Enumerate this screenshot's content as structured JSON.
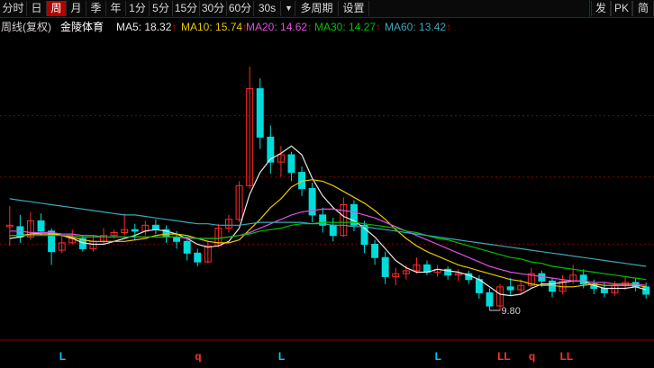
{
  "toolbar": {
    "periods": [
      "分时",
      "日",
      "周",
      "月",
      "季",
      "年",
      "1分",
      "5分",
      "15分",
      "30分",
      "60分",
      "30s"
    ],
    "active_period": "周",
    "dropdown_arrow": "▼",
    "multi_period": "多周期",
    "settings": "设置",
    "right_buttons": [
      "发",
      "PK",
      "简"
    ]
  },
  "infobar": {
    "chart_type": "周线(复权)",
    "stock_name": "金陵体育",
    "ma": [
      {
        "label": "MA5: 18.32",
        "color": "#e8e8e8"
      },
      {
        "label": "MA10: 15.74",
        "color": "#e8c800"
      },
      {
        "label": "MA20: 14.62",
        "color": "#e050e0"
      },
      {
        "label": "MA30: 14.27",
        "color": "#00c000"
      },
      {
        "label": "MA60: 13.42",
        "color": "#3aa8b8"
      }
    ],
    "up_arrow": "↑"
  },
  "colors": {
    "up": "#ff2a2a",
    "down": "#00dcdc",
    "grid": "#8b0000",
    "signal_L": "#00c8ff",
    "signal_q": "#ff3030"
  },
  "chart_data": {
    "type": "candlestick",
    "title": "金陵体育 周线(复权)",
    "ylim": [
      9.0,
      28.0
    ],
    "low_marker": "9.80",
    "candles": [
      [
        15.5,
        16.9,
        14.2,
        15.6
      ],
      [
        15.5,
        16.3,
        14.4,
        14.8
      ],
      [
        14.8,
        16.5,
        14.6,
        15.9
      ],
      [
        15.9,
        16.4,
        14.9,
        15.2
      ],
      [
        15.2,
        15.4,
        12.9,
        13.8
      ],
      [
        13.9,
        14.9,
        13.7,
        14.4
      ],
      [
        14.4,
        15.3,
        14.3,
        14.7
      ],
      [
        14.7,
        14.9,
        13.8,
        14.0
      ],
      [
        14.0,
        14.9,
        13.8,
        14.5
      ],
      [
        14.5,
        15.4,
        14.3,
        14.9
      ],
      [
        14.9,
        15.3,
        14.7,
        15.1
      ],
      [
        15.1,
        16.4,
        14.9,
        15.3
      ],
      [
        15.3,
        15.7,
        14.6,
        15.2
      ],
      [
        15.2,
        15.9,
        14.9,
        15.6
      ],
      [
        15.6,
        16.0,
        15.0,
        15.3
      ],
      [
        15.3,
        15.6,
        14.4,
        14.8
      ],
      [
        14.8,
        15.2,
        14.0,
        14.5
      ],
      [
        14.5,
        14.8,
        13.2,
        13.7
      ],
      [
        13.7,
        14.0,
        12.8,
        13.1
      ],
      [
        13.1,
        14.6,
        13.0,
        14.2
      ],
      [
        14.2,
        15.7,
        14.1,
        15.4
      ],
      [
        15.4,
        16.3,
        15.1,
        16.0
      ],
      [
        16.0,
        18.6,
        15.8,
        18.3
      ],
      [
        18.3,
        26.4,
        18.1,
        24.9
      ],
      [
        24.9,
        25.6,
        20.8,
        21.6
      ],
      [
        21.6,
        22.4,
        19.1,
        19.9
      ],
      [
        19.9,
        21.0,
        18.9,
        20.4
      ],
      [
        20.4,
        20.6,
        18.6,
        19.2
      ],
      [
        19.2,
        19.6,
        17.6,
        18.1
      ],
      [
        18.1,
        18.5,
        15.8,
        16.3
      ],
      [
        16.3,
        16.8,
        15.1,
        15.6
      ],
      [
        15.6,
        16.1,
        14.5,
        14.9
      ],
      [
        14.9,
        17.5,
        14.8,
        17.0
      ],
      [
        17.0,
        17.3,
        15.2,
        15.6
      ],
      [
        15.6,
        15.9,
        13.7,
        14.3
      ],
      [
        14.3,
        14.6,
        12.9,
        13.4
      ],
      [
        13.4,
        13.8,
        11.6,
        12.1
      ],
      [
        12.1,
        12.7,
        11.5,
        12.3
      ],
      [
        12.3,
        12.9,
        11.9,
        12.5
      ],
      [
        12.5,
        13.4,
        12.3,
        12.9
      ],
      [
        12.9,
        13.2,
        12.2,
        12.4
      ],
      [
        12.4,
        12.9,
        12.1,
        12.6
      ],
      [
        12.6,
        12.8,
        11.9,
        12.2
      ],
      [
        12.2,
        12.6,
        11.8,
        12.3
      ],
      [
        12.3,
        12.5,
        11.6,
        11.9
      ],
      [
        11.9,
        12.2,
        10.6,
        11.0
      ],
      [
        11.0,
        11.3,
        9.8,
        10.1
      ],
      [
        10.1,
        11.6,
        9.8,
        11.4
      ],
      [
        11.4,
        12.0,
        10.8,
        11.2
      ],
      [
        11.2,
        11.9,
        10.9,
        11.5
      ],
      [
        11.5,
        12.7,
        11.3,
        12.3
      ],
      [
        12.3,
        12.5,
        11.4,
        11.8
      ],
      [
        11.8,
        12.0,
        10.7,
        11.1
      ],
      [
        11.1,
        12.2,
        10.9,
        11.8
      ],
      [
        11.8,
        12.9,
        11.6,
        12.2
      ],
      [
        12.2,
        12.6,
        11.3,
        11.6
      ],
      [
        11.6,
        11.9,
        10.9,
        11.3
      ],
      [
        11.3,
        11.7,
        10.7,
        11.0
      ],
      [
        11.0,
        11.8,
        10.8,
        11.5
      ],
      [
        11.5,
        12.1,
        11.2,
        11.7
      ],
      [
        11.7,
        12.0,
        11.1,
        11.4
      ],
      [
        11.4,
        11.7,
        10.6,
        10.9
      ]
    ],
    "ma_series": [
      {
        "label": "MA5",
        "color": "#e8e8e8",
        "values": [
          14.7,
          14.8,
          15.0,
          15.1,
          15.1,
          14.9,
          14.7,
          14.4,
          14.3,
          14.3,
          14.5,
          14.7,
          14.9,
          15.2,
          15.3,
          15.2,
          15.0,
          14.7,
          14.3,
          14.1,
          14.2,
          14.5,
          15.4,
          17.7,
          19.2,
          20.1,
          20.5,
          21.0,
          20.4,
          18.8,
          17.6,
          16.8,
          16.2,
          15.9,
          15.4,
          14.8,
          14.0,
          13.2,
          12.7,
          12.4,
          12.4,
          12.6,
          12.5,
          12.4,
          12.2,
          11.9,
          11.4,
          10.9,
          10.8,
          10.9,
          11.3,
          11.6,
          11.6,
          11.7,
          11.8,
          11.8,
          11.5,
          11.3,
          11.3,
          11.3,
          11.4,
          11.2
        ]
      },
      {
        "label": "MA10",
        "color": "#e8c800",
        "values": [
          14.9,
          14.9,
          15.0,
          15.0,
          15.0,
          14.9,
          14.8,
          14.6,
          14.5,
          14.5,
          14.5,
          14.5,
          14.6,
          14.7,
          14.9,
          15.0,
          15.0,
          14.9,
          14.7,
          14.5,
          14.4,
          14.4,
          14.6,
          15.3,
          16.0,
          16.8,
          17.4,
          18.2,
          18.6,
          18.7,
          18.6,
          18.3,
          17.9,
          17.5,
          17.1,
          16.6,
          16.0,
          15.3,
          14.7,
          14.2,
          13.8,
          13.5,
          13.2,
          12.9,
          12.7,
          12.5,
          12.3,
          12.1,
          11.9,
          11.8,
          11.6,
          11.5,
          11.5,
          11.4,
          11.4,
          11.5,
          11.6,
          11.5,
          11.5,
          11.5,
          11.5,
          11.4
        ]
      },
      {
        "label": "MA20",
        "color": "#e050e0",
        "values": [
          15.2,
          15.2,
          15.1,
          15.1,
          15.1,
          15.0,
          15.0,
          14.9,
          14.9,
          14.8,
          14.8,
          14.8,
          14.8,
          14.8,
          14.8,
          14.8,
          14.8,
          14.7,
          14.7,
          14.7,
          14.7,
          14.8,
          14.9,
          15.1,
          15.4,
          15.7,
          16.0,
          16.3,
          16.5,
          16.6,
          16.7,
          16.7,
          16.6,
          16.5,
          16.3,
          16.1,
          15.8,
          15.5,
          15.2,
          14.9,
          14.6,
          14.3,
          14.0,
          13.7,
          13.4,
          13.1,
          12.8,
          12.6,
          12.4,
          12.3,
          12.2,
          12.1,
          12.0,
          11.9,
          11.8,
          11.8,
          11.7,
          11.7,
          11.6,
          11.6,
          11.6,
          11.5
        ]
      },
      {
        "label": "MA30",
        "color": "#00c000",
        "values": [
          14.9,
          14.9,
          14.9,
          14.9,
          14.9,
          14.9,
          14.9,
          14.8,
          14.8,
          14.8,
          14.8,
          14.8,
          14.8,
          14.8,
          14.8,
          14.8,
          14.8,
          14.8,
          14.7,
          14.7,
          14.7,
          14.8,
          14.9,
          15.0,
          15.2,
          15.3,
          15.4,
          15.6,
          15.7,
          15.7,
          15.8,
          15.8,
          15.8,
          15.8,
          15.7,
          15.6,
          15.5,
          15.4,
          15.2,
          15.1,
          14.9,
          14.7,
          14.6,
          14.4,
          14.2,
          14.0,
          13.8,
          13.6,
          13.4,
          13.3,
          13.1,
          13.0,
          12.8,
          12.7,
          12.6,
          12.5,
          12.4,
          12.3,
          12.2,
          12.1,
          12.0,
          11.9
        ]
      },
      {
        "label": "MA60",
        "color": "#3aa8b8",
        "values": [
          17.4,
          17.3,
          17.2,
          17.1,
          17.0,
          16.9,
          16.8,
          16.7,
          16.6,
          16.5,
          16.4,
          16.3,
          16.3,
          16.2,
          16.1,
          16.0,
          15.9,
          15.8,
          15.7,
          15.7,
          15.6,
          15.6,
          15.6,
          15.7,
          15.8,
          15.8,
          15.8,
          15.8,
          15.8,
          15.7,
          15.7,
          15.6,
          15.6,
          15.5,
          15.5,
          15.4,
          15.3,
          15.2,
          15.1,
          15.0,
          14.9,
          14.8,
          14.7,
          14.6,
          14.5,
          14.4,
          14.3,
          14.2,
          14.1,
          14.0,
          13.9,
          13.8,
          13.7,
          13.6,
          13.5,
          13.4,
          13.3,
          13.2,
          13.1,
          13.0,
          12.9,
          12.8
        ]
      }
    ],
    "signals": [
      {
        "index": 5,
        "text": "L",
        "color": "#00c8ff"
      },
      {
        "index": 18,
        "text": "q",
        "color": "#ff3030"
      },
      {
        "index": 26,
        "text": "L",
        "color": "#00c8ff"
      },
      {
        "index": 41,
        "text": "L",
        "color": "#00c8ff"
      },
      {
        "index": 47,
        "text": "LL",
        "color": "#ff3030"
      },
      {
        "index": 50,
        "text": "q",
        "color": "#ff3030"
      },
      {
        "index": 53,
        "text": "LL",
        "color": "#ff3030"
      }
    ]
  }
}
